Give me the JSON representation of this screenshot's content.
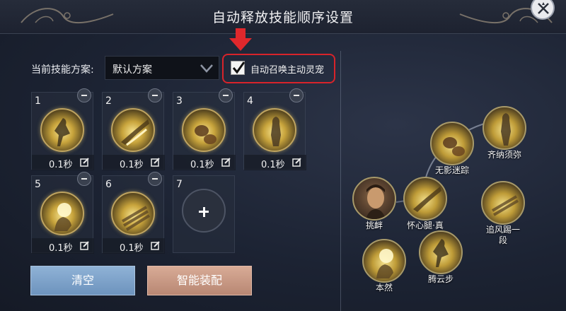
{
  "window": {
    "title": "自动释放技能顺序设置"
  },
  "scheme": {
    "label": "当前技能方案:",
    "selected": "默认方案"
  },
  "summon_pet": {
    "label": "自动召唤主动灵宠",
    "checked": true
  },
  "slots": [
    {
      "number": "1",
      "cooldown": "0.1秒"
    },
    {
      "number": "2",
      "cooldown": "0.1秒"
    },
    {
      "number": "3",
      "cooldown": "0.1秒"
    },
    {
      "number": "4",
      "cooldown": "0.1秒"
    },
    {
      "number": "5",
      "cooldown": "0.1秒"
    },
    {
      "number": "6",
      "cooldown": "0.1秒"
    },
    {
      "number": "7"
    }
  ],
  "buttons": {
    "clear": "清空",
    "smart_equip": "智能装配"
  },
  "skill_tree": [
    {
      "name": "齐纳须弥"
    },
    {
      "name": "无影迷踪"
    },
    {
      "name": "挑衅"
    },
    {
      "name": "怀心腿·真"
    },
    {
      "name": "追风踢一\n段"
    },
    {
      "name": "本然"
    },
    {
      "name": "腾云步"
    }
  ],
  "colors": {
    "highlight_border": "#d8232a",
    "clear_button": "#7ea3ca",
    "smart_button": "#c99a85"
  }
}
